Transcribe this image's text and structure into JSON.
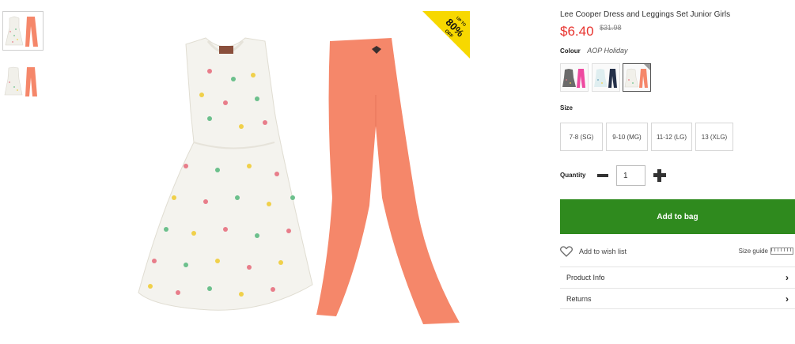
{
  "thumbnails": [
    {
      "icon": "dress-and-leggings-thumbnail-front"
    },
    {
      "icon": "dress-and-leggings-thumbnail-back"
    }
  ],
  "promo": {
    "line1": "UP TO",
    "line2": "80%",
    "line3": "OFF",
    "color": "#f7d800"
  },
  "product": {
    "title": "Lee Cooper Dress and Leggings Set Junior Girls",
    "price": "$6.40",
    "was_price": "$31.98"
  },
  "colour": {
    "label": "Colour",
    "value": "AOP Holiday",
    "swatches": [
      {
        "name": "pink-print"
      },
      {
        "name": "navy-print"
      },
      {
        "name": "aop-holiday",
        "selected": true
      }
    ]
  },
  "size": {
    "label": "Size",
    "options": [
      "7-8 (SG)",
      "9-10 (MG)",
      "11-12 (LG)",
      "13 (XLG)"
    ]
  },
  "quantity": {
    "label": "Quantity",
    "value": "1"
  },
  "add_to_bag": {
    "label": "Add to bag",
    "color": "#2f8a1e"
  },
  "wish_list": {
    "label": "Add to wish list"
  },
  "size_guide": {
    "label": "Size guide"
  },
  "accordion": [
    {
      "label": "Product Info"
    },
    {
      "label": "Returns"
    }
  ],
  "colors": {
    "price": "#e8332e",
    "leggings": "#f5876a",
    "dress": "#f4f3ee"
  }
}
